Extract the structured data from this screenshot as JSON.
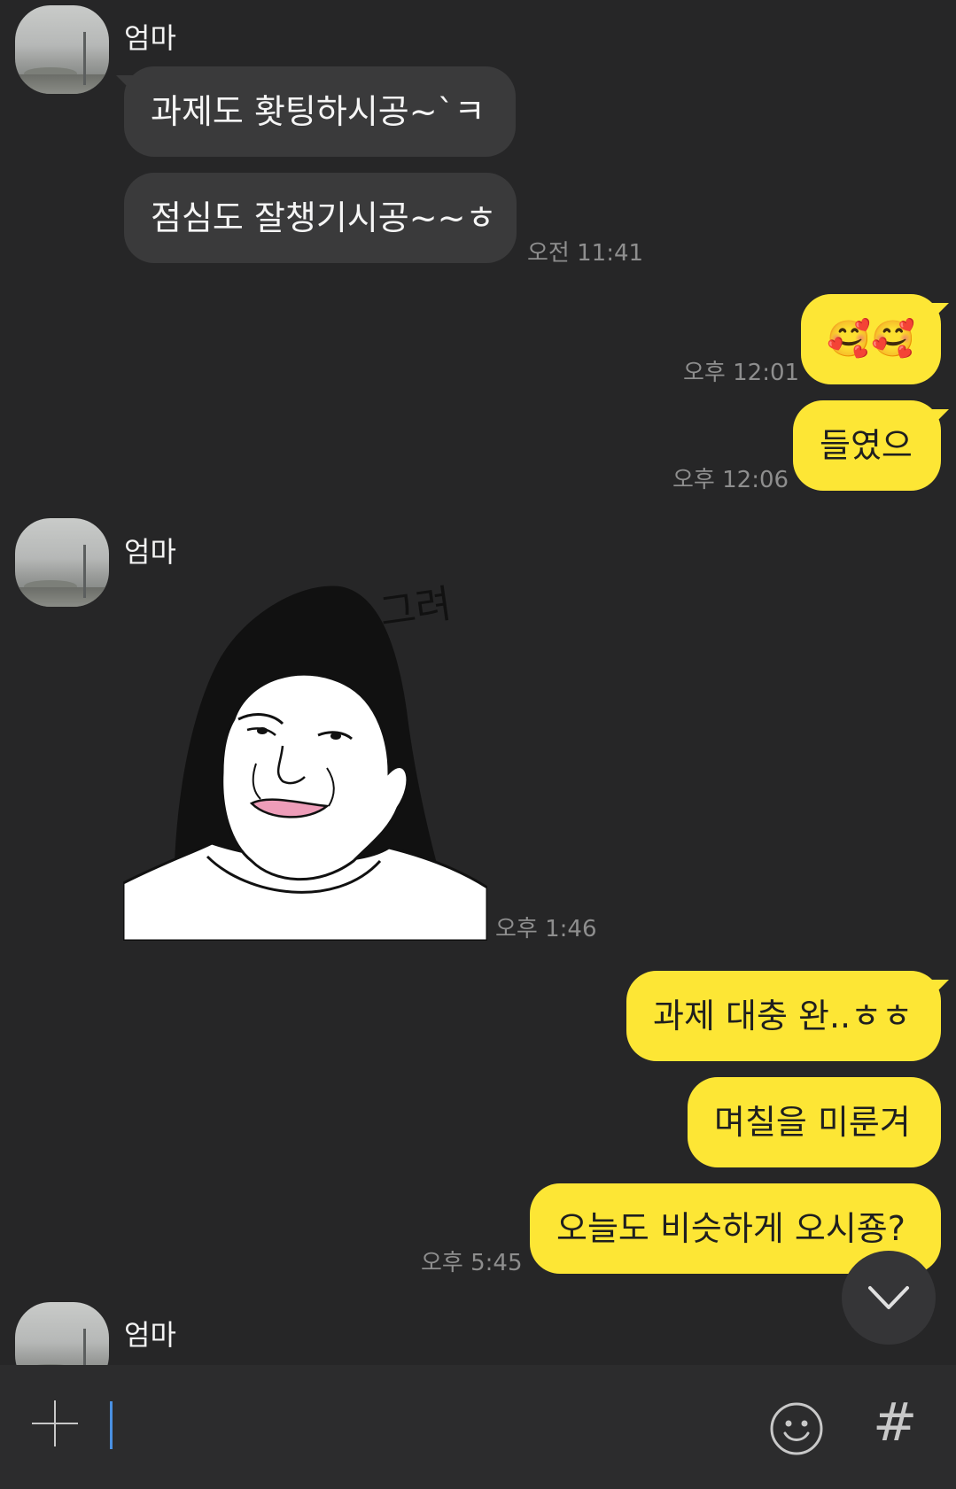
{
  "messages": {
    "m1_sender": "엄마",
    "m1_text1": "과제도 홧팅하시공~`ㅋ",
    "m1_text2": "점심도 잘챙기시공~~ㅎ",
    "m1_time": "오전 11:41",
    "m2_text": "🥰🥰",
    "m2_time": "오후 12:01",
    "m3_text": "들였으",
    "m3_time": "오후 12:06",
    "m4_sender": "엄마",
    "m4_sticker_text": "그려",
    "m4_time": "오후 1:46",
    "m5_text1": "과제 대충 완..ㅎㅎ",
    "m5_text2": "며칠을 미룬겨",
    "m5_text3": "오늘도 비슷하게 오시죵?",
    "m5_time": "오후 5:45",
    "m6_sender": "엄마"
  },
  "input": {
    "plus_icon": "plus-icon",
    "emoji_icon": "smiley-icon",
    "hash_label": "#"
  },
  "colors": {
    "background": "#262627",
    "incoming_bubble": "#3a3a3b",
    "outgoing_bubble": "#fde635",
    "timestamp": "#8e8e8e"
  }
}
